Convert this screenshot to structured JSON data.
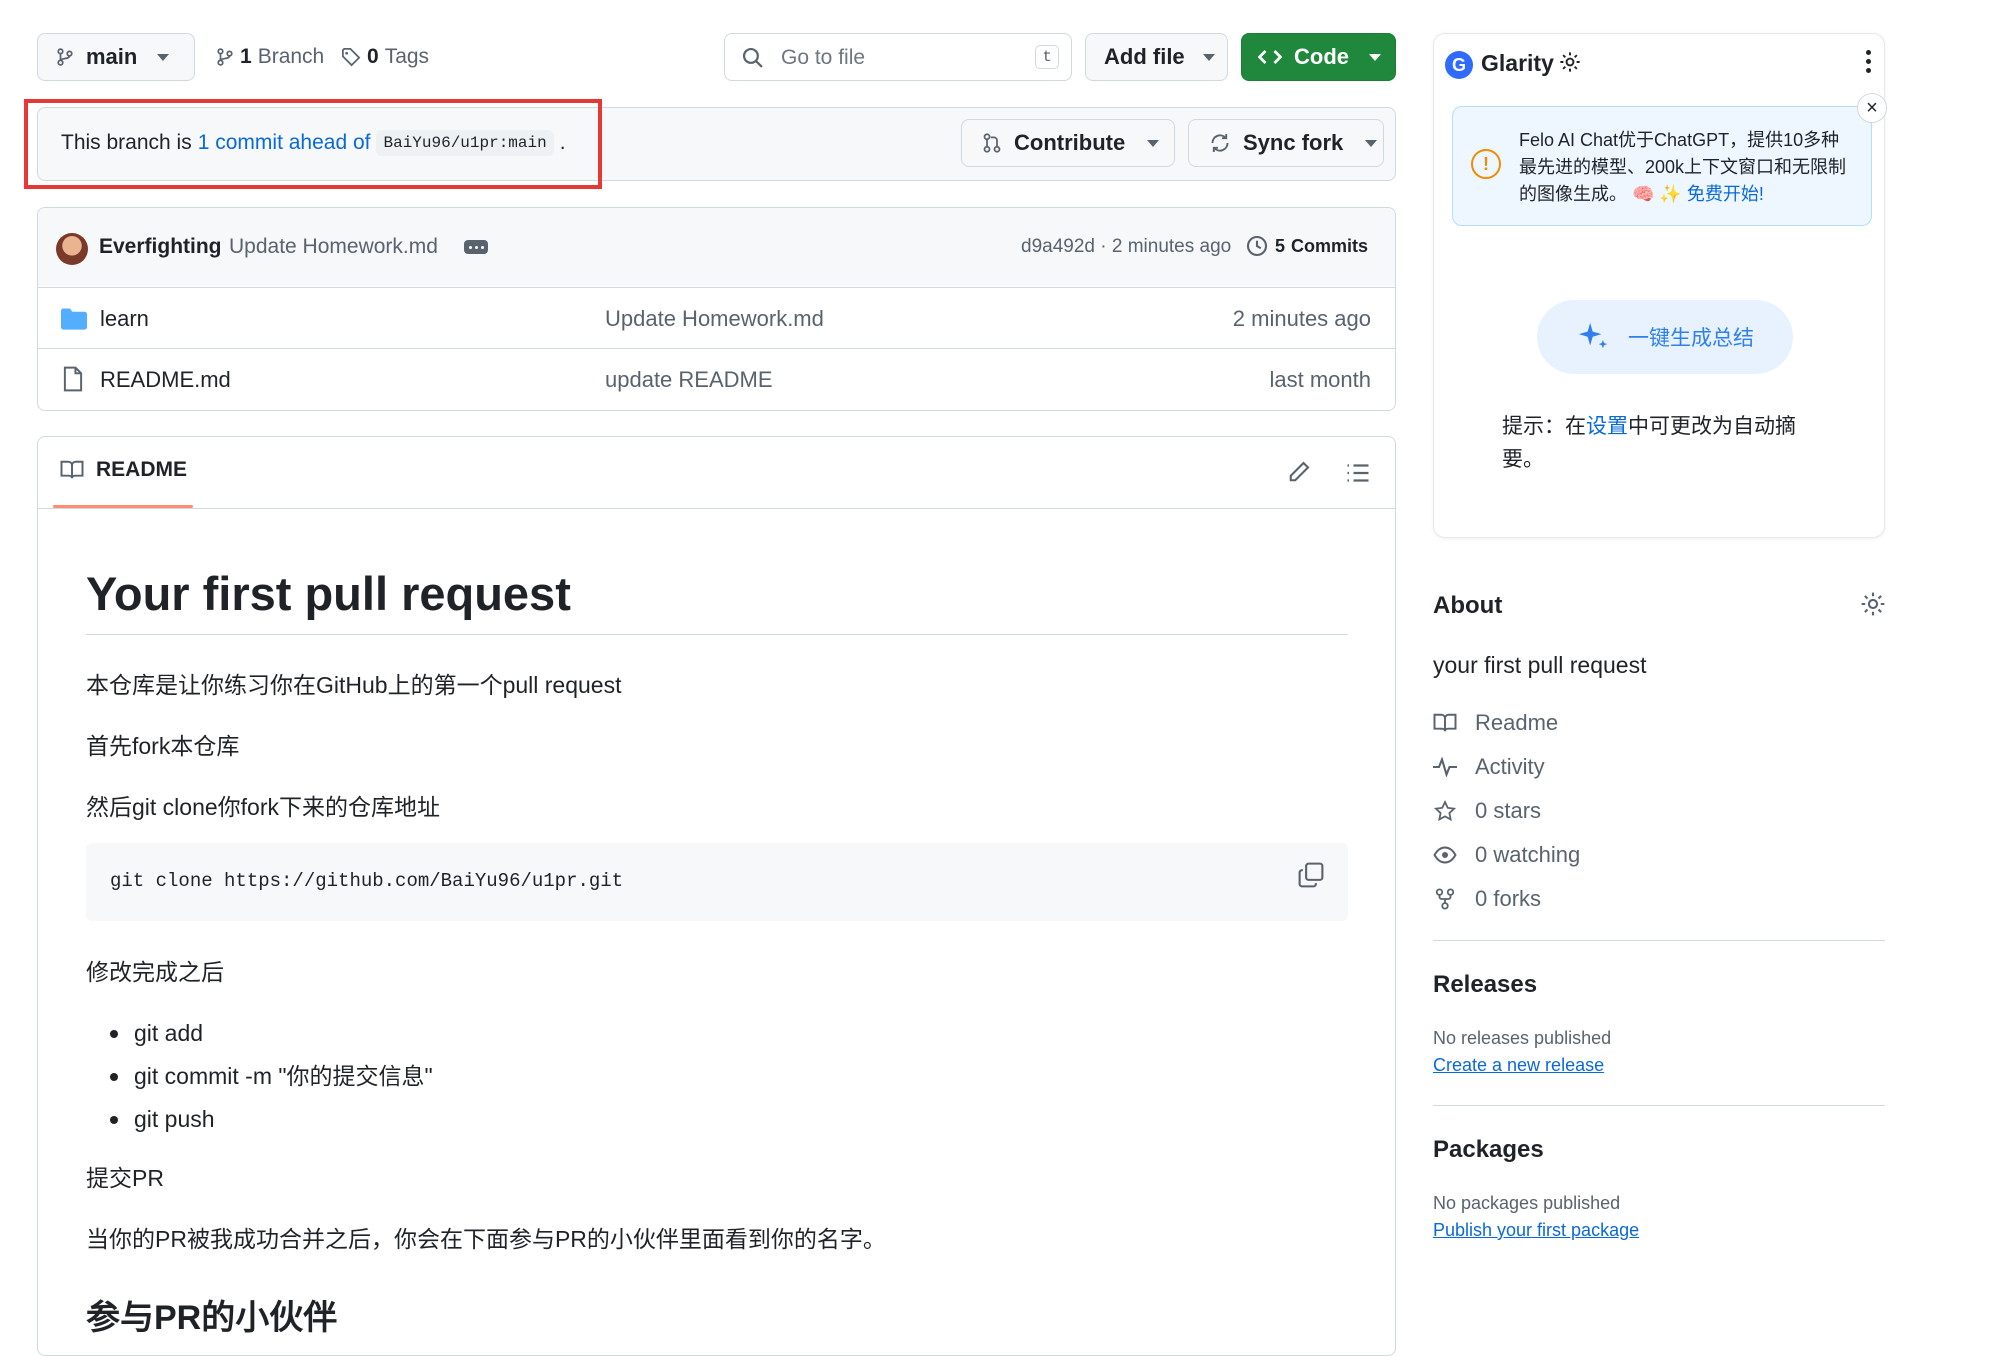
{
  "toolbar": {
    "branch": "main",
    "branches_count": "1",
    "branches_label": "Branch",
    "tags_count": "0",
    "tags_label": "Tags",
    "search_placeholder": "Go to file",
    "search_shortcut": "t",
    "add_file": "Add file",
    "code": "Code"
  },
  "banner": {
    "prefix": "This branch is",
    "ahead_link": "1 commit ahead of",
    "ref": "BaiYu96/u1pr:main",
    "suffix": ".",
    "contribute": "Contribute",
    "sync_fork": "Sync fork"
  },
  "commit": {
    "author": "Everfighting",
    "message": "Update Homework.md",
    "hash_time": "d9a492d · 2 minutes ago",
    "commits_count": "5",
    "commits_label": "Commits"
  },
  "files": [
    {
      "name": "learn",
      "type": "folder",
      "message": "Update Homework.md",
      "time": "2 minutes ago"
    },
    {
      "name": "README.md",
      "type": "file",
      "message": "update README",
      "time": "last month"
    }
  ],
  "readme": {
    "tab": "README",
    "h1": "Your first pull request",
    "p1": "本仓库是让你练习你在GitHub上的第一个pull request",
    "p2": "首先fork本仓库",
    "p3": "然后git clone你fork下来的仓库地址",
    "code": "git clone https://github.com/BaiYu96/u1pr.git",
    "p4": "修改完成之后",
    "list": [
      "git add",
      "git commit -m \"你的提交信息\"",
      "git push"
    ],
    "p5": "提交PR",
    "p6": "当你的PR被我成功合并之后，你会在下面参与PR的小伙伴里面看到你的名字。",
    "h2": "参与PR的小伙伴"
  },
  "glarity": {
    "title": "Glarity",
    "notice": "Felo AI Chat优于ChatGPT，提供10多种最先进的模型、200k上下文窗口和无限制的图像生成。",
    "notice_emoji": "🧠 ✨",
    "notice_link": "免费开始!",
    "summary_button": "一键生成总结",
    "tip_prefix": "提示：在",
    "tip_link": "设置",
    "tip_suffix": "中可更改为自动摘要。"
  },
  "about": {
    "title": "About",
    "description": "your first pull request",
    "items": [
      {
        "icon": "book-icon",
        "text": "Readme"
      },
      {
        "icon": "pulse-icon",
        "text": "Activity"
      },
      {
        "icon": "star-icon",
        "text": "0 stars"
      },
      {
        "icon": "eye-icon",
        "text": "0 watching"
      },
      {
        "icon": "fork-icon",
        "text": "0 forks"
      }
    ]
  },
  "releases": {
    "title": "Releases",
    "empty": "No releases published",
    "link": "Create a new release"
  },
  "packages": {
    "title": "Packages",
    "empty": "No packages published",
    "link": "Publish your first package"
  },
  "colors": {
    "primary": "#1f883d",
    "link": "#0969da",
    "highlight": "#e53935",
    "tab_underline": "#fd8c73"
  }
}
